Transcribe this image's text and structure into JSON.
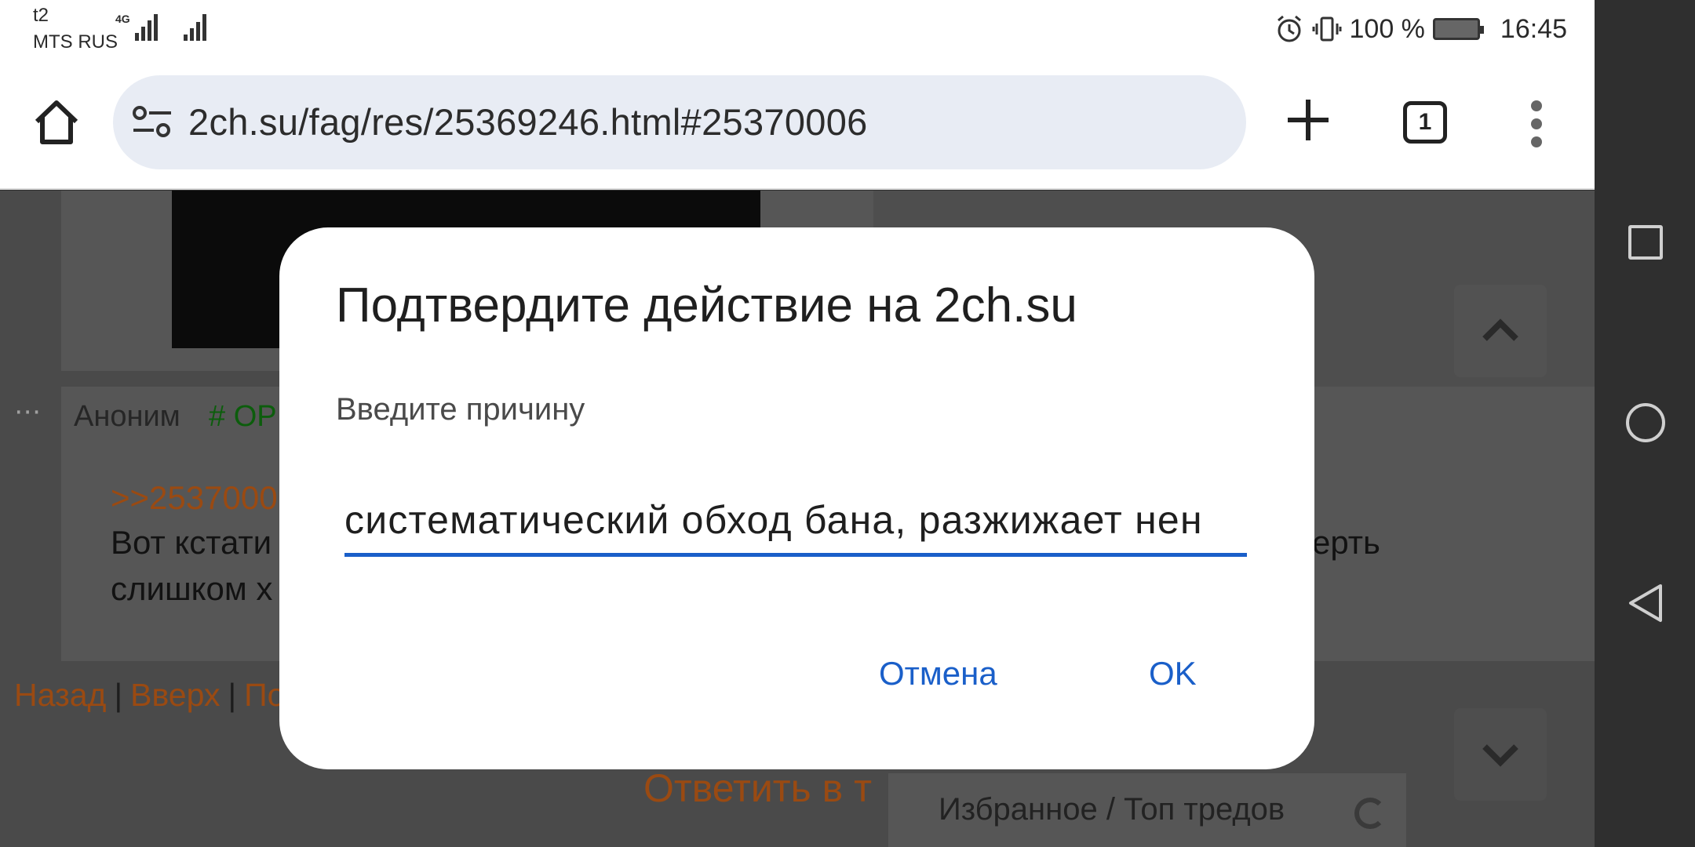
{
  "status_bar": {
    "carrier_top": "t2",
    "carrier_bottom": "MTS RUS",
    "network": "4G",
    "battery": "100 %",
    "time": "16:45"
  },
  "browser": {
    "url": "2ch.su/fag/res/25369246.html#25370006",
    "tab_count": "1"
  },
  "page": {
    "post2": {
      "name": "Аноним",
      "op_tag": "# OP",
      "reply_ref": ">>2537000",
      "line1": "Вот кстати",
      "line2": "слишком х",
      "line1_tail": "ерть"
    },
    "nav": {
      "back": "Назад",
      "sep": "|",
      "up": "Вверх",
      "more": "По"
    },
    "reply_button": "Ответить в т",
    "favorites": "Избранное / Топ тредов"
  },
  "dialog": {
    "title": "Подтвердите действие на 2ch.su",
    "label": "Введите причину",
    "input_value": "систематический обход бана, разжижает нен",
    "cancel": "Отмена",
    "ok": "OK"
  },
  "colors": {
    "accent": "#1a5fc9",
    "link": "#9a4a12",
    "op_tag": "#0c5d0c"
  }
}
